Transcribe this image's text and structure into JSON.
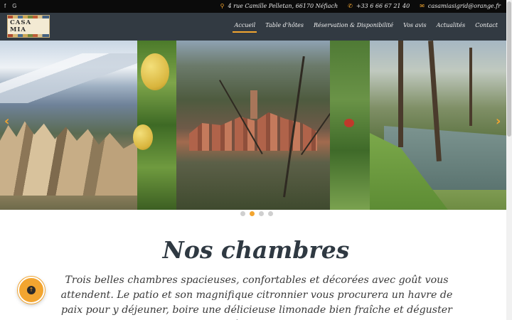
{
  "topbar": {
    "social": [
      {
        "label": "f",
        "icon": "facebook-icon"
      },
      {
        "label": "G",
        "icon": "google-icon"
      }
    ],
    "address": "4 rue Camille Pelletan, 66170 Néfiach",
    "phone": "+33 6 66 67 21 40",
    "email": "casamiasigrid@orange.fr",
    "icon_address": "map-pin-icon",
    "icon_phone": "phone-icon",
    "icon_email": "envelope-icon"
  },
  "logo": {
    "text": "CASA MIA"
  },
  "nav": {
    "items": [
      "Accueil",
      "Table d'hôtes",
      "Réservation & Disponibilité",
      "Vos avis",
      "Actualités",
      "Contact"
    ],
    "active_index": 0
  },
  "slider": {
    "prev_symbol": "‹",
    "next_symbol": "›",
    "dots": 4,
    "active_dot": 1
  },
  "content": {
    "title": "Nos chambres",
    "text": "Trois belles chambres spacieuses, confortables et décorées avec goût vous attendent. Le patio et son magnifique citronnier vous procurera un havre de paix pour y déjeuner, boire une délicieuse limonade bien fraîche et déguster en table d'hôtes la bonne cuisine"
  },
  "fab": {
    "symbol": "↑",
    "icon": "arrow-up-icon"
  },
  "colors": {
    "accent": "#f2a530",
    "nav_bg": "#323a42",
    "topbar_bg": "#0b0b0b",
    "title": "#2f3942"
  }
}
